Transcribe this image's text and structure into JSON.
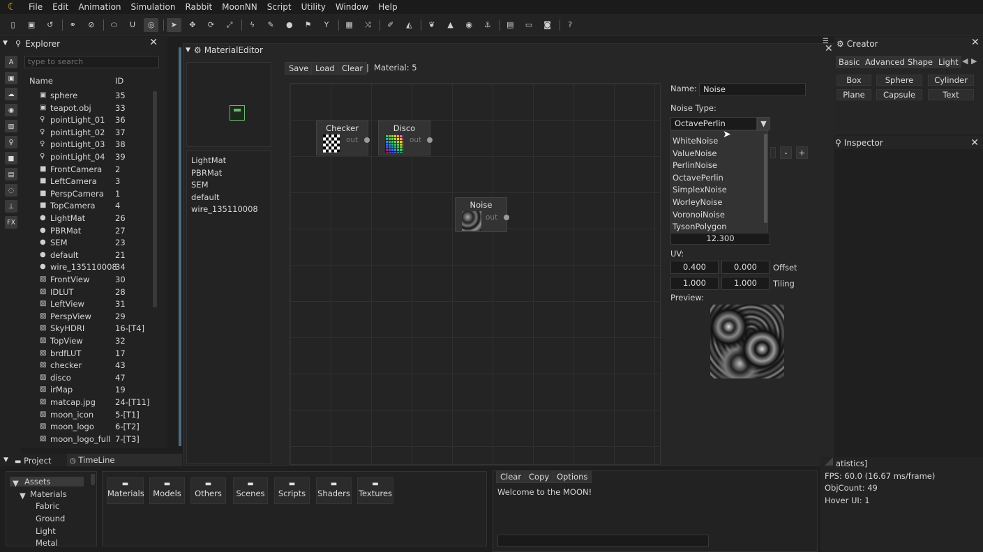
{
  "menubar": {
    "items": [
      "File",
      "Edit",
      "Animation",
      "Simulation",
      "Rabbit",
      "MoonNN",
      "Script",
      "Utility",
      "Window",
      "Help"
    ]
  },
  "toolbar": {
    "icons": [
      "new-file-icon",
      "save-icon",
      "undo-icon",
      "link-icon",
      "unlink-icon",
      "toggle-icon",
      "magnet-icon",
      "target-icon",
      "cursor-icon",
      "move-icon",
      "rotate-icon",
      "scale-icon",
      "lightning-icon",
      "eraser-icon",
      "drop-icon",
      "flag-icon",
      "filter-icon",
      "grid-icon",
      "shuffle-icon",
      "brush-icon",
      "terrain-icon",
      "leaf-icon",
      "mountain-icon",
      "globe-icon",
      "anchor-icon",
      "keyboard-icon",
      "window-icon",
      "camera-icon",
      "help-icon"
    ]
  },
  "sidebar_strip": {
    "items": [
      "A",
      "cube",
      "cloud",
      "globe",
      "image",
      "bulb",
      "video",
      "doc",
      "shape",
      "pin",
      "FX"
    ]
  },
  "explorer": {
    "title": "Explorer",
    "search_placeholder": "type to search",
    "col_name": "Name",
    "col_id": "ID",
    "rows": [
      {
        "icon": "cube-icon",
        "name": "sphere",
        "id": "35"
      },
      {
        "icon": "cube-icon",
        "name": "teapot.obj",
        "id": "33"
      },
      {
        "icon": "bulb-icon",
        "name": "pointLight_01",
        "id": "36"
      },
      {
        "icon": "bulb-icon",
        "name": "pointLight_02",
        "id": "37"
      },
      {
        "icon": "bulb-icon",
        "name": "pointLight_03",
        "id": "38"
      },
      {
        "icon": "bulb-icon",
        "name": "pointLight_04",
        "id": "39"
      },
      {
        "icon": "camera-icon",
        "name": "FrontCamera",
        "id": "2"
      },
      {
        "icon": "camera-icon",
        "name": "LeftCamera",
        "id": "3"
      },
      {
        "icon": "camera-icon",
        "name": "PerspCamera",
        "id": "1"
      },
      {
        "icon": "camera-icon",
        "name": "TopCamera",
        "id": "4"
      },
      {
        "icon": "material-icon",
        "name": "LightMat",
        "id": "26"
      },
      {
        "icon": "material-icon",
        "name": "PBRMat",
        "id": "27"
      },
      {
        "icon": "material-icon",
        "name": "SEM",
        "id": "23"
      },
      {
        "icon": "material-icon",
        "name": "default",
        "id": "21"
      },
      {
        "icon": "material-icon",
        "name": "wire_135110008",
        "id": "34"
      },
      {
        "icon": "image-icon",
        "name": "FrontView",
        "id": "30"
      },
      {
        "icon": "image-icon",
        "name": "IDLUT",
        "id": "28"
      },
      {
        "icon": "image-icon",
        "name": "LeftView",
        "id": "31"
      },
      {
        "icon": "image-icon",
        "name": "PerspView",
        "id": "29"
      },
      {
        "icon": "image-icon",
        "name": "SkyHDRI",
        "id": "16-[T4]"
      },
      {
        "icon": "image-icon",
        "name": "TopView",
        "id": "32"
      },
      {
        "icon": "image-icon",
        "name": "brdfLUT",
        "id": "17"
      },
      {
        "icon": "image-icon",
        "name": "checker",
        "id": "43"
      },
      {
        "icon": "image-icon",
        "name": "disco",
        "id": "47"
      },
      {
        "icon": "image-icon",
        "name": "irMap",
        "id": "19"
      },
      {
        "icon": "image-icon",
        "name": "matcap.jpg",
        "id": "24-[T11]"
      },
      {
        "icon": "image-icon",
        "name": "moon_icon",
        "id": "5-[T1]"
      },
      {
        "icon": "image-icon",
        "name": "moon_logo",
        "id": "6-[T2]"
      },
      {
        "icon": "image-icon",
        "name": "moon_logo_full",
        "id": "7-[T3]"
      }
    ]
  },
  "material_editor": {
    "title": "MaterialEditor",
    "save": "Save",
    "load": "Load",
    "clear": "Clear",
    "separator": "|",
    "material_label": "Material: 5",
    "materials": [
      "LightMat",
      "PBRMat",
      "SEM",
      "default",
      "wire_135110008"
    ],
    "nodes": {
      "checker": {
        "title": "Checker",
        "out": "out"
      },
      "disco": {
        "title": "Disco",
        "out": "out"
      },
      "noise": {
        "title": "Noise",
        "out": "out"
      }
    },
    "props": {
      "name_label": "Name:",
      "name_value": "Noise",
      "noise_type_label": "Noise Type:",
      "noise_type_value": "OctavePerlin",
      "noise_options": [
        "WhiteNoise",
        "ValueNoise",
        "PerlinNoise",
        "OctavePerlin",
        "SimplexNoise",
        "WorleyNoise",
        "VoronoiNoise",
        "TysonPolygon"
      ],
      "minus": "-",
      "plus": "+",
      "scale_value": "12.300",
      "uv_label": "UV:",
      "offset_x": "0.400",
      "offset_y": "0.000",
      "offset_label": "Offset",
      "tiling_x": "1.000",
      "tiling_y": "1.000",
      "tiling_label": "Tiling",
      "preview_label": "Preview:"
    }
  },
  "creator": {
    "title": "Creator",
    "tabs": [
      "Basic",
      "Advanced",
      "Shape",
      "Light"
    ],
    "buttons": [
      "Box",
      "Sphere",
      "Cylinder",
      "Plane",
      "Capsule",
      "Text"
    ]
  },
  "inspector": {
    "title": "Inspector"
  },
  "project": {
    "tab_project": "Project",
    "tab_timeline": "TimeLine",
    "tree": {
      "root": "Assets",
      "folder": "Materials",
      "children": [
        "Fabric",
        "Ground",
        "Light",
        "Metal"
      ]
    },
    "folders": [
      "Materials",
      "Models",
      "Others",
      "Scenes",
      "Scripts",
      "Shaders",
      "Textures"
    ]
  },
  "console": {
    "clear": "Clear",
    "copy": "Copy",
    "options": "Options",
    "message": "Welcome to the MOON!"
  },
  "statistics": {
    "title": "atistics]",
    "fps": "FPS: 60.0 (16.67 ms/frame)",
    "objcount": "ObjCount: 49",
    "hover": "Hover UI: 1"
  },
  "colors": {
    "accent": "#6fb86f",
    "background": "#1e1e1e",
    "panel": "#262626"
  }
}
